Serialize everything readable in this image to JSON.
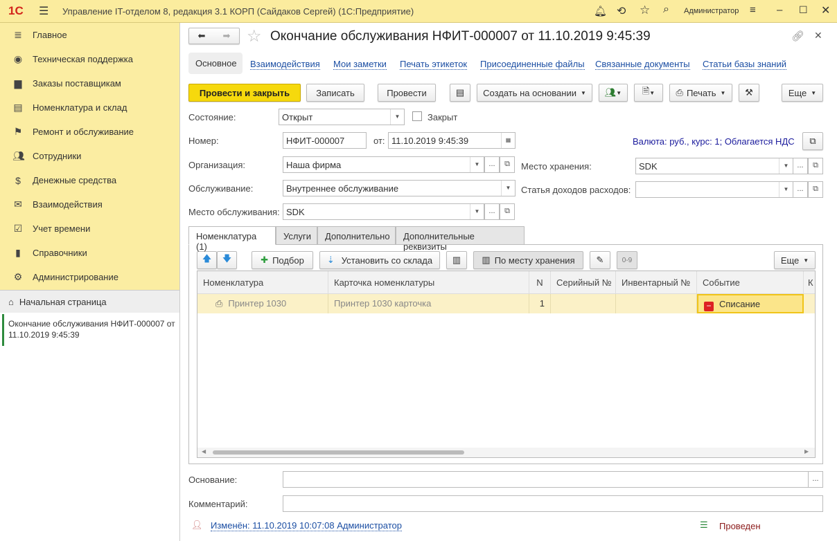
{
  "app": {
    "title": "Управление IT-отделом 8, редакция 3.1 КОРП (Сайдаков Сергей)  (1С:Предприятие)",
    "user": "Администратор"
  },
  "sidebar": {
    "items": [
      {
        "label": "Главное",
        "icon": "menu-icon"
      },
      {
        "label": "Техническая поддержка",
        "icon": "support-icon"
      },
      {
        "label": "Заказы поставщикам",
        "icon": "truck-icon"
      },
      {
        "label": "Номенклатура и склад",
        "icon": "printer-icon"
      },
      {
        "label": "Ремонт и обслуживание",
        "icon": "flag-icon"
      },
      {
        "label": "Сотрудники",
        "icon": "people-icon"
      },
      {
        "label": "Денежные средства",
        "icon": "money-icon"
      },
      {
        "label": "Взаимодействия",
        "icon": "mail-icon"
      },
      {
        "label": "Учет времени",
        "icon": "calendar-icon"
      },
      {
        "label": "Справочники",
        "icon": "book-icon"
      },
      {
        "label": "Администрирование",
        "icon": "gear-icon"
      }
    ],
    "home": "Начальная страница",
    "open_doc": "Окончание обслуживания НФИТ-000007 от 11.10.2019 9:45:39"
  },
  "doc": {
    "title": "Окончание обслуживания НФИТ-000007 от 11.10.2019 9:45:39",
    "nav": [
      "Основное",
      "Взаимодействия",
      "Мои заметки",
      "Печать этикеток",
      "Присоединенные файлы",
      "Связанные документы",
      "Статьи базы знаний"
    ],
    "toolbar": {
      "post_close": "Провести и закрыть",
      "save": "Записать",
      "post": "Провести",
      "create_based": "Создать на основании",
      "print": "Печать",
      "more": "Еще"
    },
    "fields": {
      "state_label": "Состояние:",
      "state": "Открыт",
      "closed_label": "Закрыт",
      "number_label": "Номер:",
      "number": "НФИТ-000007",
      "from_label": "от:",
      "date": "11.10.2019  9:45:39",
      "org_label": "Организация:",
      "org": "Наша фирма",
      "service_label": "Обслуживание:",
      "service": "Внутреннее обслуживание",
      "place_label": "Место обслуживания:",
      "place": "SDK",
      "currency": "Валюта: руб., курс: 1; Облагается НДС",
      "storage_label": "Место хранения:",
      "storage": "SDK",
      "article_label": "Статья доходов расходов:",
      "article": "",
      "basis_label": "Основание:",
      "basis": "",
      "comment_label": "Комментарий:",
      "comment": ""
    },
    "tabs": [
      "Номенклатура (1)",
      "Услуги",
      "Дополнительно",
      "Дополнительные реквизиты"
    ],
    "table_toolbar": {
      "pick": "Подбор",
      "set_from_wh": "Установить со склада",
      "by_place": "По месту хранения",
      "more": "Еще"
    },
    "columns": [
      "Номенклатура",
      "Карточка номенклатуры",
      "N",
      "Серийный №",
      "Инвентарный №",
      "Событие",
      "К"
    ],
    "rows": [
      {
        "item": "Принтер 1030",
        "card": "Принтер 1030 карточка",
        "n": "1",
        "serial": "",
        "inv": "",
        "event": "Списание"
      }
    ],
    "footer": {
      "changed": "Изменён: 11.10.2019 10:07:08 Администратор",
      "status": "Проведен"
    }
  }
}
